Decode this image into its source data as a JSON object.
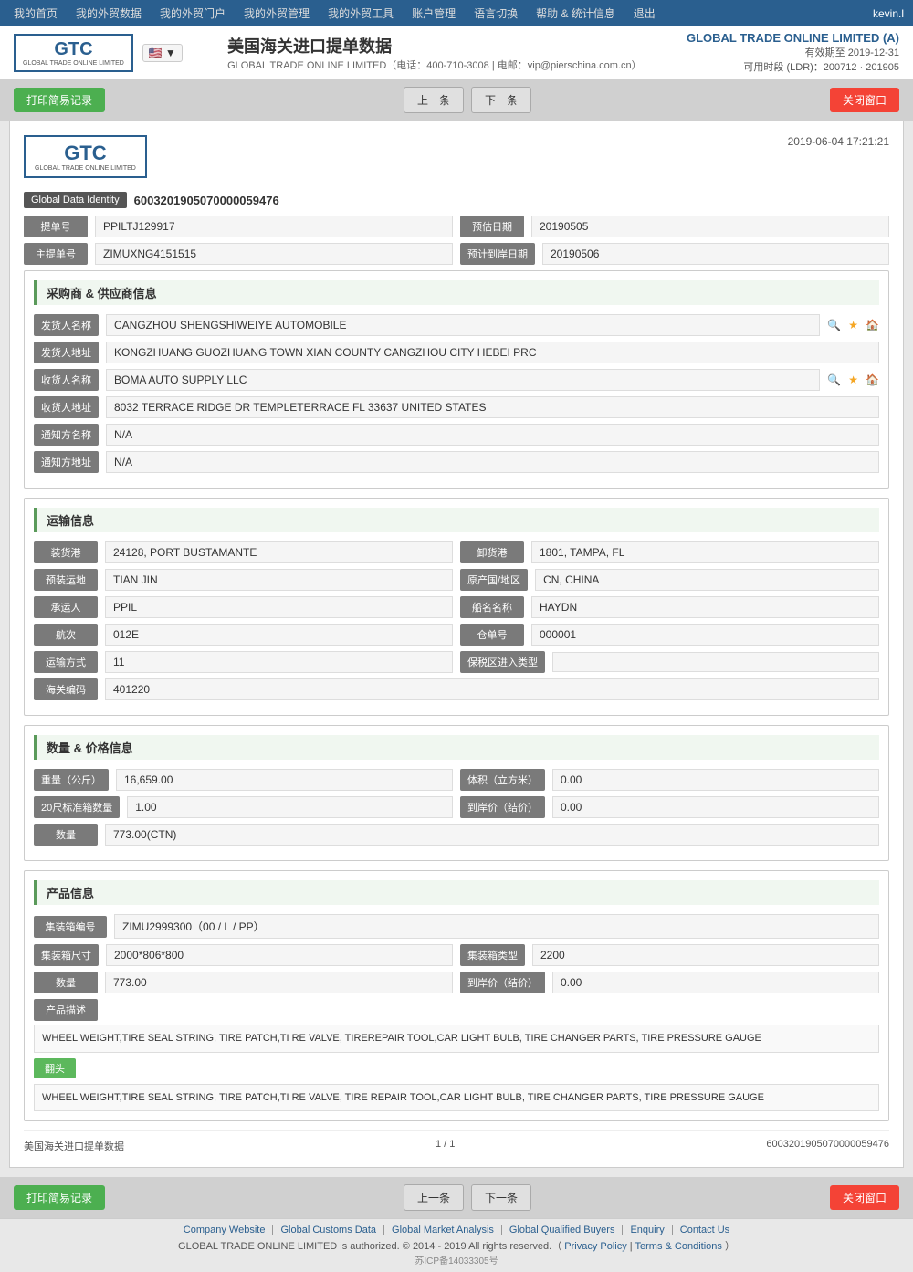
{
  "nav": {
    "items": [
      "我的首页",
      "我的外贸数据",
      "我的外贸门户",
      "我的外贸管理",
      "我的外贸工具",
      "账户管理",
      "语言切换",
      "帮助 & 统计信息",
      "退出"
    ],
    "user": "kevin.l"
  },
  "header": {
    "logo_text": "GTC",
    "logo_sub": "GLOBAL TRADE ONLINE LIMITED",
    "title": "美国海关进口提单数据",
    "subtitle": "GLOBAL TRADE ONLINE LIMITED（电话：400-710-3008 | 电邮：vip@pierschina.com.cn）",
    "company": "GLOBAL TRADE ONLINE LIMITED (A)",
    "expire": "有效期至 2019-12-31",
    "time": "可用时段 (LDR)：200712 · 201905"
  },
  "toolbar": {
    "print_btn": "打印简易记录",
    "prev_btn": "上一条",
    "next_btn": "下一条",
    "close_btn": "关闭窗口"
  },
  "doc": {
    "logo_text": "GTC",
    "logo_sub": "GLOBAL TRADE ONLINE LIMITED",
    "date": "2019-06-04 17:21:21",
    "gdi_label": "Global Data Identity",
    "gdi_value": "6003201905070000059476",
    "bill_label": "提单号",
    "bill_value": "PPILTJ129917",
    "arrival_label": "预估日期",
    "arrival_value": "20190505",
    "main_bill_label": "主提单号",
    "main_bill_value": "ZIMUXNG4151515",
    "eta_label": "预计到岸日期",
    "eta_value": "20190506"
  },
  "supplier": {
    "section_title": "采购商 & 供应商信息",
    "shipper_name_label": "发货人名称",
    "shipper_name_value": "CANGZHOU SHENGSHIWEIYE AUTOMOBILE",
    "shipper_addr_label": "发货人地址",
    "shipper_addr_value": "KONGZHUANG GUOZHUANG TOWN XIAN COUNTY CANGZHOU CITY HEBEI PRC",
    "consignee_name_label": "收货人名称",
    "consignee_name_value": "BOMA AUTO SUPPLY LLC",
    "consignee_addr_label": "收货人地址",
    "consignee_addr_value": "8032 TERRACE RIDGE DR TEMPLETERRACE FL 33637 UNITED STATES",
    "notify_name_label": "通知方名称",
    "notify_name_value": "N/A",
    "notify_addr_label": "通知方地址",
    "notify_addr_value": "N/A"
  },
  "transport": {
    "section_title": "运输信息",
    "loading_port_label": "装货港",
    "loading_port_value": "24128, PORT BUSTAMANTE",
    "unloading_port_label": "卸货港",
    "unloading_port_value": "1801, TAMPA, FL",
    "pre_transport_label": "预装运地",
    "pre_transport_value": "TIAN JIN",
    "origin_label": "原产国/地区",
    "origin_value": "CN, CHINA",
    "carrier_label": "承运人",
    "carrier_value": "PPIL",
    "vessel_label": "船名名称",
    "vessel_value": "HAYDN",
    "voyage_label": "航次",
    "voyage_value": "012E",
    "warehouse_label": "仓单号",
    "warehouse_value": "000001",
    "transport_mode_label": "运输方式",
    "transport_mode_value": "11",
    "bonded_label": "保税区进入类型",
    "bonded_value": "",
    "customs_label": "海关编码",
    "customs_value": "401220"
  },
  "quantity": {
    "section_title": "数量 & 价格信息",
    "weight_label": "重量（公斤）",
    "weight_value": "16,659.00",
    "volume_label": "体积（立方米）",
    "volume_value": "0.00",
    "container20_label": "20尺标准箱数量",
    "container20_value": "1.00",
    "arrival_price_label": "到岸价（结价）",
    "arrival_price_value": "0.00",
    "quantity_label": "数量",
    "quantity_value": "773.00(CTN)"
  },
  "product": {
    "section_title": "产品信息",
    "container_no_label": "集装箱编号",
    "container_no_value": "ZIMU2999300（00 / L / PP）",
    "container_size_label": "集装箱尺寸",
    "container_size_value": "2000*806*800",
    "container_type_label": "集装箱类型",
    "container_type_value": "2200",
    "quantity_label": "数量",
    "quantity_value": "773.00",
    "arrival_price_label": "到岸价（结价）",
    "arrival_price_value": "0.00",
    "desc_label": "产品描述",
    "desc_value": "WHEEL WEIGHT,TIRE SEAL STRING, TIRE PATCH,TI RE VALVE, TIREREPAIR TOOL,CAR LIGHT BULB, TIRE CHANGER PARTS, TIRE PRESSURE GAUGE",
    "translate_btn": "翻头",
    "translated_value": "WHEEL WEIGHT,TIRE SEAL STRING, TIRE PATCH,TI RE VALVE, TIRE REPAIR TOOL,CAR LIGHT BULB, TIRE CHANGER PARTS, TIRE PRESSURE GAUGE"
  },
  "doc_footer": {
    "source": "美国海关进口提单数据",
    "page": "1 / 1",
    "id": "6003201905070000059476"
  },
  "footer": {
    "icp": "苏ICP备14033305号",
    "links": [
      "Company Website",
      "Global Customs Data",
      "Global Market Analysis",
      "Global Qualified Buyers",
      "Enquiry",
      "Contact Us"
    ],
    "copyright": "GLOBAL TRADE ONLINE LIMITED is authorized. © 2014 - 2019 All rights reserved.（",
    "privacy": "Privacy Policy",
    "separator1": "|",
    "terms": "Terms & Conditions",
    "separator2": "）"
  }
}
